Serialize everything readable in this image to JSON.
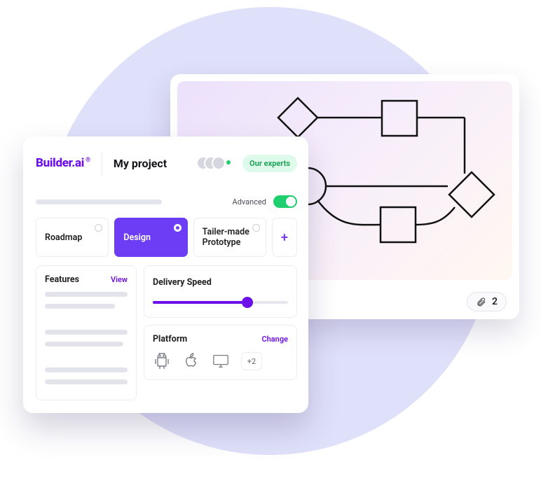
{
  "brand": {
    "name": "Builder.ai",
    "registered": "®"
  },
  "project": {
    "title": "My project"
  },
  "header": {
    "experts_badge": "Our experts"
  },
  "advanced": {
    "label": "Advanced",
    "on": true
  },
  "tabs": {
    "roadmap": "Roadmap",
    "design": "Design",
    "prototype": "Tailer-made Prototype",
    "add": "+"
  },
  "features": {
    "title": "Features",
    "view": "View"
  },
  "delivery": {
    "title": "Delivery Speed",
    "percent": 70
  },
  "platform": {
    "title": "Platform",
    "change": "Change",
    "more": "+2",
    "icons": {
      "android": "android-icon",
      "apple": "apple-icon",
      "desktop": "desktop-icon"
    }
  },
  "attachment": {
    "count": "2"
  },
  "colors": {
    "accent": "#6c0fe8",
    "accent2": "#6c3df4",
    "green": "#1fce6d"
  }
}
